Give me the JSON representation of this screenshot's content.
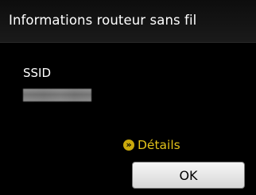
{
  "header": {
    "title": "Informations routeur sans fil"
  },
  "field": {
    "label": "SSID",
    "value_obscured": true
  },
  "details": {
    "icon": "double-chevron-right-icon",
    "label": "Détails"
  },
  "ok_button": {
    "label": "OK"
  },
  "colors": {
    "background": "#000000",
    "accent": "#e2c21a",
    "text": "#ffffff"
  }
}
